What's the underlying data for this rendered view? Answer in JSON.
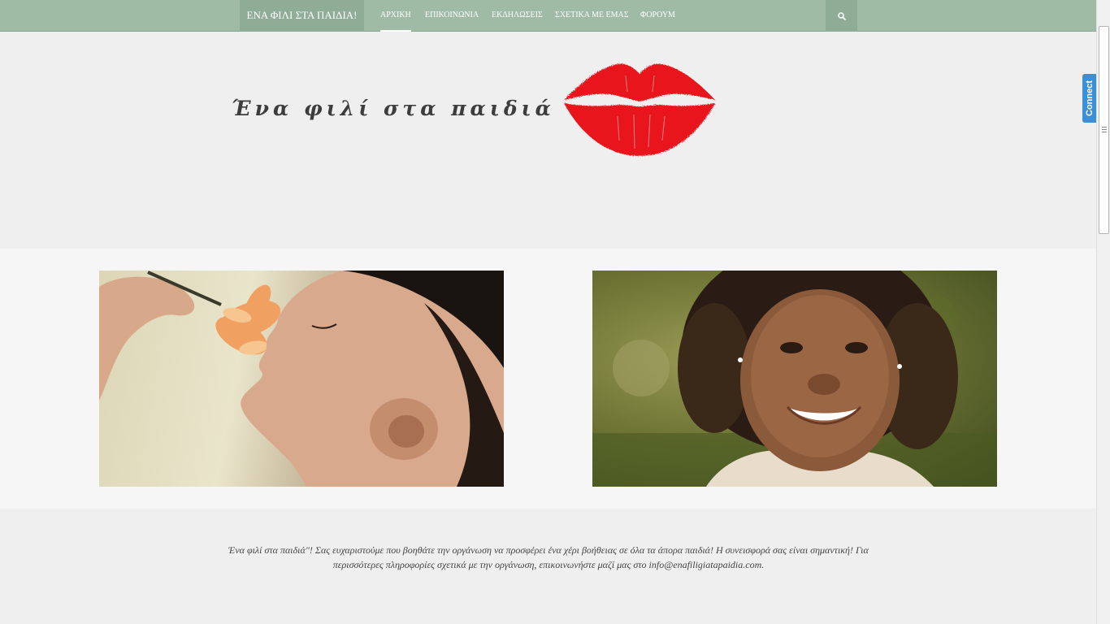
{
  "nav": {
    "brand": "ΕΝΑ ΦΙΛΙ ΣΤΑ ΠΑΙΔΙΑ!",
    "items": [
      {
        "label": "ΑΡΧΙΚΗ",
        "active": true
      },
      {
        "label": "ΕΠΙΚΟΙΝΩΝΙΑ",
        "active": false
      },
      {
        "label": "ΕΚΔΗΛΩΣΕΙΣ",
        "active": false
      },
      {
        "label": "ΣΧΕΤΙΚΑ ΜΕ ΕΜΑΣ",
        "active": false
      },
      {
        "label": "ΦΟΡΟΥΜ",
        "active": false
      }
    ],
    "search_icon": "search-icon"
  },
  "hero": {
    "title": "Ένα φιλί στα παιδιά",
    "logo_icon": "lips-icon"
  },
  "footer": {
    "text": "Ένα φιλί στα παιδιά\"! Σας ευχαριστούμε που βοηθάτε την οργάνωση να προσφέρει ένα χέρι βοήθειας σε όλα τα άπορα παιδιά! Η συνεισφορά σας είναι σημαντική! Για περισσότερες πληροφορίες σχετικά με την οργάνωση, επικοινωνήστε μαζί μας στο info@enafiligiatapaidia.com."
  },
  "connect": {
    "label": "Connect"
  },
  "colors": {
    "navbar": "#9fbaa5",
    "lips": "#e8141c",
    "connect": "#3b8fd6"
  }
}
